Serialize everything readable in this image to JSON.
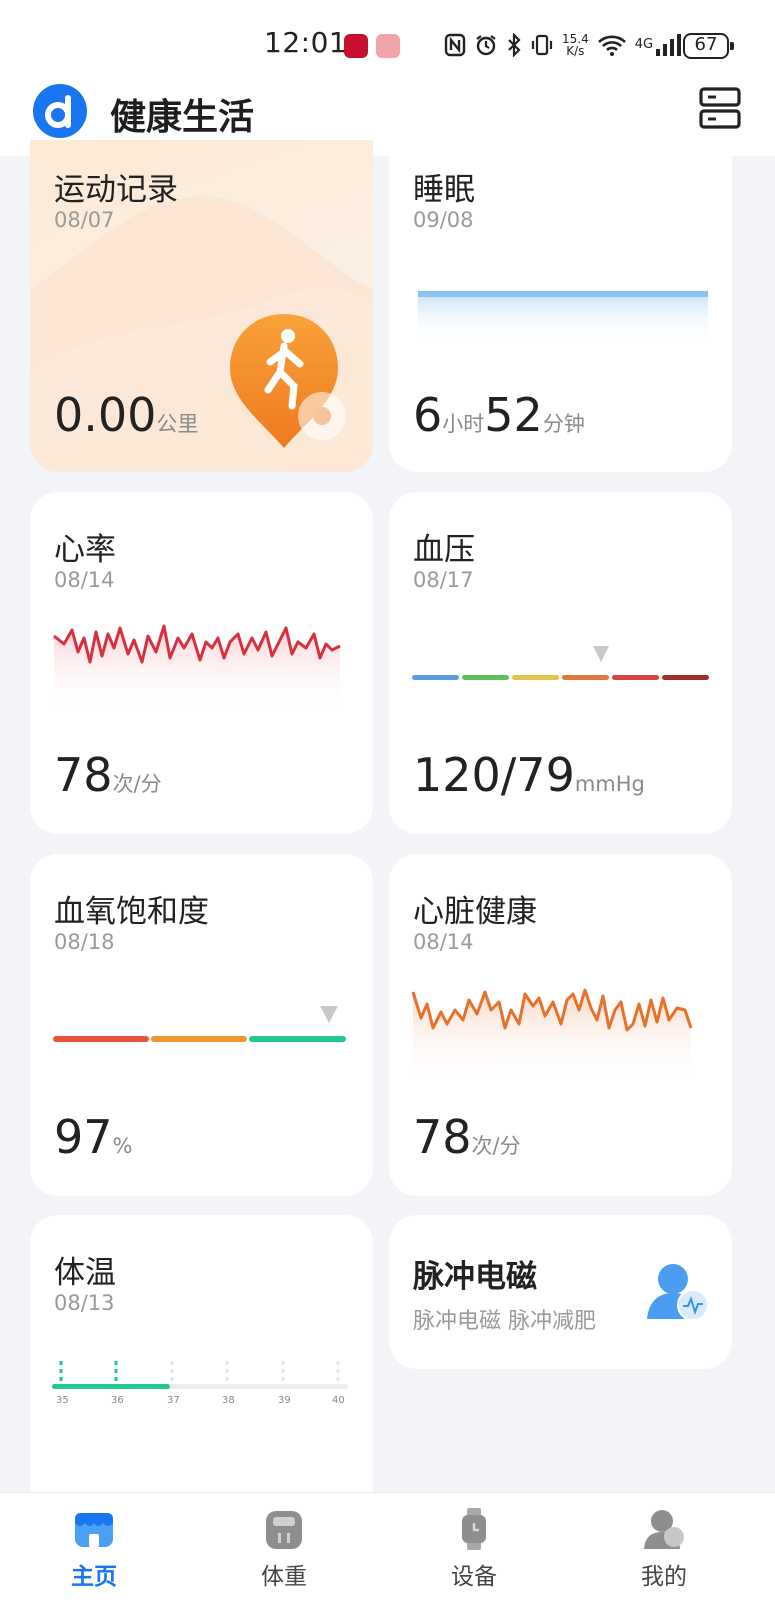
{
  "status_bar": {
    "time": "12:01",
    "net_speed_value": "15.4",
    "net_speed_unit": "K/s",
    "network_type": "4G",
    "battery": "67"
  },
  "header": {
    "title": "健康生活"
  },
  "cards": {
    "exercise": {
      "title": "运动记录",
      "date": "08/07",
      "value": "0.00",
      "unit": "公里"
    },
    "sleep": {
      "title": "睡眠",
      "date": "09/08",
      "hours": "6",
      "hours_unit": "小时",
      "minutes": "52",
      "minutes_unit": "分钟"
    },
    "heart_rate": {
      "title": "心率",
      "date": "08/14",
      "value": "78",
      "unit": "次/分"
    },
    "blood_pressure": {
      "title": "血压",
      "date": "08/17",
      "value": "120/79",
      "unit": "mmHg"
    },
    "spo2": {
      "title": "血氧饱和度",
      "date": "08/18",
      "value": "97",
      "unit": "%"
    },
    "heart_health": {
      "title": "心脏健康",
      "date": "08/14",
      "value": "78",
      "unit": "次/分"
    },
    "temperature": {
      "title": "体温",
      "date": "08/13",
      "scale": [
        "35",
        "36",
        "37",
        "38",
        "39",
        "40"
      ]
    },
    "pulse": {
      "title": "脉冲电磁",
      "subtitle": "脉冲电磁 脉冲减肥"
    }
  },
  "bottom_nav": {
    "items": [
      {
        "label": "主页",
        "icon": "home-store-icon",
        "active": true
      },
      {
        "label": "体重",
        "icon": "scale-icon",
        "active": false
      },
      {
        "label": "设备",
        "icon": "watch-icon",
        "active": false
      },
      {
        "label": "我的",
        "icon": "profile-icon",
        "active": false
      }
    ]
  },
  "colors": {
    "accent": "#1976f0",
    "heart_rate_line": "#d9303e",
    "heart_health_line": "#e8702a",
    "temperature_bar": "#1fc98e",
    "bp_segments": [
      "#5b9be0",
      "#5cc05c",
      "#e4c34a",
      "#e07a3a",
      "#d9443a",
      "#a02e2a"
    ],
    "spo2_segments": [
      "#e8553a",
      "#f0962e",
      "#1fc98e"
    ]
  }
}
